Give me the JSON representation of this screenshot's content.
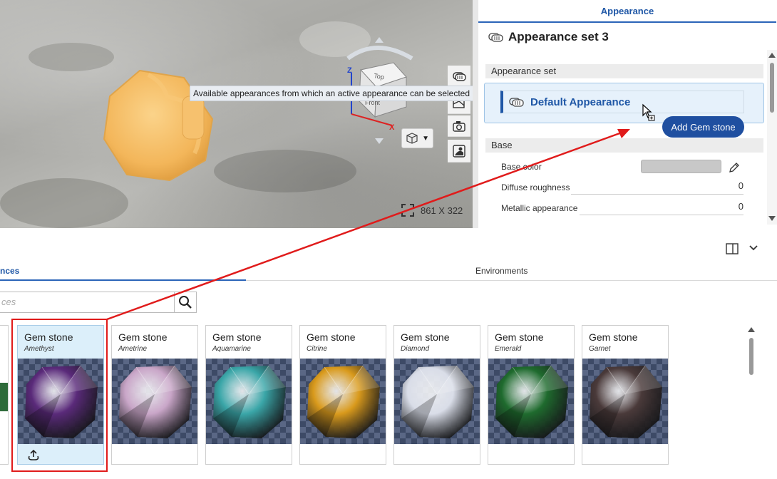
{
  "viewport": {
    "tooltip": "Available appearances from which an active appearance can be selected",
    "navcube": {
      "axis_z": "Z",
      "axis_x": "X",
      "face_top": "Top",
      "face_front": "Front"
    },
    "dimensions": "861 X 322",
    "tools": [
      "appearances-icon",
      "section-view-icon",
      "camera-icon",
      "render-icon"
    ],
    "view_dropdown_icon": "cube-icon",
    "gem_color": "#f3b65a"
  },
  "right_panel": {
    "tab_label": "Appearance",
    "title": "Appearance set 3",
    "section_appearance_set": "Appearance set",
    "default_appearance": "Default Appearance",
    "add_button": "Add Gem stone",
    "section_base": "Base",
    "props": [
      {
        "label": "Base color",
        "value": ""
      },
      {
        "label": "Diffuse roughness",
        "value": "0"
      },
      {
        "label": "Metallic appearance",
        "value": "0"
      }
    ],
    "base_color_swatch": "#c8c8c8"
  },
  "bottom_panel": {
    "tab_appearances": "nces",
    "tab_environments": "Environments",
    "search_placeholder": "ces",
    "cards": [
      {
        "name": "Gem stone",
        "sub": "Amethyst",
        "color": "#5a2a7a",
        "selected": true
      },
      {
        "name": "Gem stone",
        "sub": "Ametrine",
        "color": "#c9a6c8",
        "selected": false
      },
      {
        "name": "Gem stone",
        "sub": "Aquamarine",
        "color": "#3aa6a8",
        "selected": false
      },
      {
        "name": "Gem stone",
        "sub": "Citrine",
        "color": "#d99a1c",
        "selected": false
      },
      {
        "name": "Gem stone",
        "sub": "Diamond",
        "color": "#d9dde8",
        "selected": false
      },
      {
        "name": "Gem stone",
        "sub": "Emerald",
        "color": "#1f6b2e",
        "selected": false
      },
      {
        "name": "Gem stone",
        "sub": "Garnet",
        "color": "#4a3a3a",
        "selected": false
      }
    ],
    "accent": "#1f57a6",
    "highlight": "#e01b1b"
  }
}
